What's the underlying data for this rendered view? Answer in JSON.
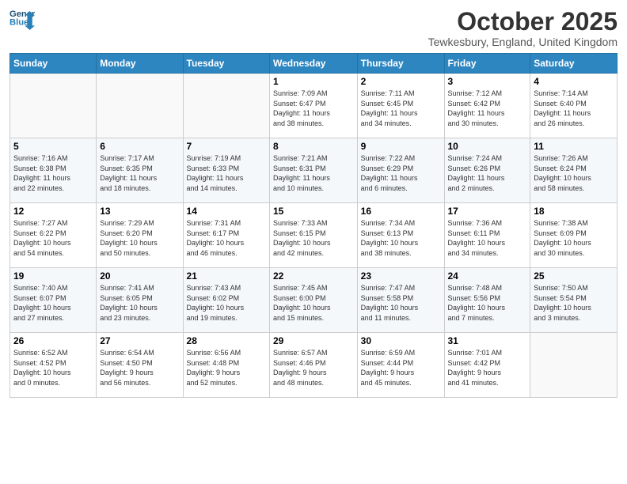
{
  "header": {
    "logo_line1": "General",
    "logo_line2": "Blue",
    "month": "October 2025",
    "location": "Tewkesbury, England, United Kingdom"
  },
  "days_of_week": [
    "Sunday",
    "Monday",
    "Tuesday",
    "Wednesday",
    "Thursday",
    "Friday",
    "Saturday"
  ],
  "weeks": [
    [
      {
        "day": "",
        "info": ""
      },
      {
        "day": "",
        "info": ""
      },
      {
        "day": "",
        "info": ""
      },
      {
        "day": "1",
        "info": "Sunrise: 7:09 AM\nSunset: 6:47 PM\nDaylight: 11 hours\nand 38 minutes."
      },
      {
        "day": "2",
        "info": "Sunrise: 7:11 AM\nSunset: 6:45 PM\nDaylight: 11 hours\nand 34 minutes."
      },
      {
        "day": "3",
        "info": "Sunrise: 7:12 AM\nSunset: 6:42 PM\nDaylight: 11 hours\nand 30 minutes."
      },
      {
        "day": "4",
        "info": "Sunrise: 7:14 AM\nSunset: 6:40 PM\nDaylight: 11 hours\nand 26 minutes."
      }
    ],
    [
      {
        "day": "5",
        "info": "Sunrise: 7:16 AM\nSunset: 6:38 PM\nDaylight: 11 hours\nand 22 minutes."
      },
      {
        "day": "6",
        "info": "Sunrise: 7:17 AM\nSunset: 6:35 PM\nDaylight: 11 hours\nand 18 minutes."
      },
      {
        "day": "7",
        "info": "Sunrise: 7:19 AM\nSunset: 6:33 PM\nDaylight: 11 hours\nand 14 minutes."
      },
      {
        "day": "8",
        "info": "Sunrise: 7:21 AM\nSunset: 6:31 PM\nDaylight: 11 hours\nand 10 minutes."
      },
      {
        "day": "9",
        "info": "Sunrise: 7:22 AM\nSunset: 6:29 PM\nDaylight: 11 hours\nand 6 minutes."
      },
      {
        "day": "10",
        "info": "Sunrise: 7:24 AM\nSunset: 6:26 PM\nDaylight: 11 hours\nand 2 minutes."
      },
      {
        "day": "11",
        "info": "Sunrise: 7:26 AM\nSunset: 6:24 PM\nDaylight: 10 hours\nand 58 minutes."
      }
    ],
    [
      {
        "day": "12",
        "info": "Sunrise: 7:27 AM\nSunset: 6:22 PM\nDaylight: 10 hours\nand 54 minutes."
      },
      {
        "day": "13",
        "info": "Sunrise: 7:29 AM\nSunset: 6:20 PM\nDaylight: 10 hours\nand 50 minutes."
      },
      {
        "day": "14",
        "info": "Sunrise: 7:31 AM\nSunset: 6:17 PM\nDaylight: 10 hours\nand 46 minutes."
      },
      {
        "day": "15",
        "info": "Sunrise: 7:33 AM\nSunset: 6:15 PM\nDaylight: 10 hours\nand 42 minutes."
      },
      {
        "day": "16",
        "info": "Sunrise: 7:34 AM\nSunset: 6:13 PM\nDaylight: 10 hours\nand 38 minutes."
      },
      {
        "day": "17",
        "info": "Sunrise: 7:36 AM\nSunset: 6:11 PM\nDaylight: 10 hours\nand 34 minutes."
      },
      {
        "day": "18",
        "info": "Sunrise: 7:38 AM\nSunset: 6:09 PM\nDaylight: 10 hours\nand 30 minutes."
      }
    ],
    [
      {
        "day": "19",
        "info": "Sunrise: 7:40 AM\nSunset: 6:07 PM\nDaylight: 10 hours\nand 27 minutes."
      },
      {
        "day": "20",
        "info": "Sunrise: 7:41 AM\nSunset: 6:05 PM\nDaylight: 10 hours\nand 23 minutes."
      },
      {
        "day": "21",
        "info": "Sunrise: 7:43 AM\nSunset: 6:02 PM\nDaylight: 10 hours\nand 19 minutes."
      },
      {
        "day": "22",
        "info": "Sunrise: 7:45 AM\nSunset: 6:00 PM\nDaylight: 10 hours\nand 15 minutes."
      },
      {
        "day": "23",
        "info": "Sunrise: 7:47 AM\nSunset: 5:58 PM\nDaylight: 10 hours\nand 11 minutes."
      },
      {
        "day": "24",
        "info": "Sunrise: 7:48 AM\nSunset: 5:56 PM\nDaylight: 10 hours\nand 7 minutes."
      },
      {
        "day": "25",
        "info": "Sunrise: 7:50 AM\nSunset: 5:54 PM\nDaylight: 10 hours\nand 3 minutes."
      }
    ],
    [
      {
        "day": "26",
        "info": "Sunrise: 6:52 AM\nSunset: 4:52 PM\nDaylight: 10 hours\nand 0 minutes."
      },
      {
        "day": "27",
        "info": "Sunrise: 6:54 AM\nSunset: 4:50 PM\nDaylight: 9 hours\nand 56 minutes."
      },
      {
        "day": "28",
        "info": "Sunrise: 6:56 AM\nSunset: 4:48 PM\nDaylight: 9 hours\nand 52 minutes."
      },
      {
        "day": "29",
        "info": "Sunrise: 6:57 AM\nSunset: 4:46 PM\nDaylight: 9 hours\nand 48 minutes."
      },
      {
        "day": "30",
        "info": "Sunrise: 6:59 AM\nSunset: 4:44 PM\nDaylight: 9 hours\nand 45 minutes."
      },
      {
        "day": "31",
        "info": "Sunrise: 7:01 AM\nSunset: 4:42 PM\nDaylight: 9 hours\nand 41 minutes."
      },
      {
        "day": "",
        "info": ""
      }
    ]
  ]
}
